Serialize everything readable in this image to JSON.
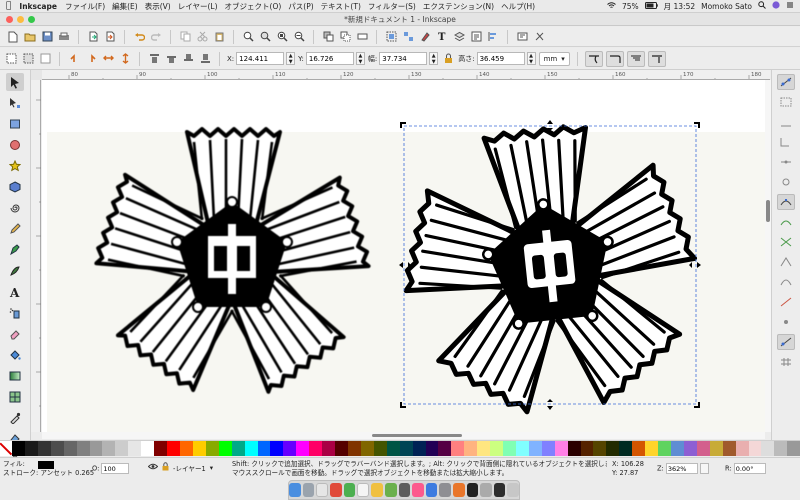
{
  "menubar": {
    "app_name": "Inkscape",
    "items": [
      "ファイル(F)",
      "編集(E)",
      "表示(V)",
      "レイヤー(L)",
      "オブジェクト(O)",
      "パス(P)",
      "テキスト(T)",
      "フィルター(S)",
      "エクステンション(N)",
      "ヘルプ(H)"
    ],
    "battery": "75%",
    "clock": "月 13:52",
    "user": "Momoko Sato"
  },
  "window": {
    "title": "*新規ドキュメント 1 - Inkscape"
  },
  "controls": {
    "x_label": "X:",
    "x_value": "124.411",
    "y_label": "Y:",
    "y_value": "16.726",
    "w_label": "幅:",
    "w_value": "37.734",
    "h_label": "高さ:",
    "h_value": "36.459",
    "unit": "mm"
  },
  "ruler": {
    "h_ticks": [
      "80",
      "90",
      "100",
      "110",
      "120",
      "130",
      "140",
      "150",
      "160",
      "170",
      "180"
    ]
  },
  "status": {
    "fill_label": "フィル:",
    "stroke_label": "ストローク:",
    "stroke_value": "アンセット",
    "stroke_width": "0.265",
    "opacity_label": "O:",
    "opacity_value": "100",
    "layer": "-レイヤー1",
    "message_line1": "Shift: クリックで追加選択、ドラッグでラバーバンド選択します。; Alt: クリックで背面側に隠れているオブジェクトを選択します。",
    "message_line2": "マウススクロールで画面を移動。ドラッグで選択オブジェクトを移動または拡大縮小します。",
    "x_label": "X:",
    "x_value": "106.28",
    "y_label": "Y:",
    "y_value": "27.87",
    "zoom_label": "Z:",
    "zoom_value": "362%",
    "rot_label": "R:",
    "rot_value": "0.00°"
  },
  "palette_colors": [
    "#000000",
    "#1a1a1a",
    "#333333",
    "#4d4d4d",
    "#666666",
    "#808080",
    "#999999",
    "#b3b3b3",
    "#cccccc",
    "#e6e6e6",
    "#ffffff",
    "#800000",
    "#ff0000",
    "#ff6600",
    "#ffcc00",
    "#88aa00",
    "#00ff00",
    "#00aa88",
    "#00ffff",
    "#0066ff",
    "#0000ff",
    "#6600ff",
    "#ff00ff",
    "#ff0066",
    "#aa0044",
    "#550000",
    "#803300",
    "#806600",
    "#445500",
    "#005544",
    "#004455",
    "#002255",
    "#220055",
    "#550044",
    "#ff8080",
    "#ffb380",
    "#ffe680",
    "#ccff80",
    "#80ffb3",
    "#80ffff",
    "#80b3ff",
    "#8080ff",
    "#ff80e6",
    "#2b0000",
    "#552200",
    "#554400",
    "#222b00",
    "#002b22",
    "#d45500",
    "#ffd42a",
    "#5fd35f",
    "#5f8dd3",
    "#8d5fd3",
    "#d35f8d",
    "#c8ab37",
    "#a05a2c",
    "#e9afaf",
    "#f4d7d7",
    "#dddddd",
    "#bbbbbb",
    "#999999"
  ],
  "colors": {
    "selection": "#3b6bd6",
    "canvas": "#ffffff",
    "chrome": "#ececec"
  }
}
